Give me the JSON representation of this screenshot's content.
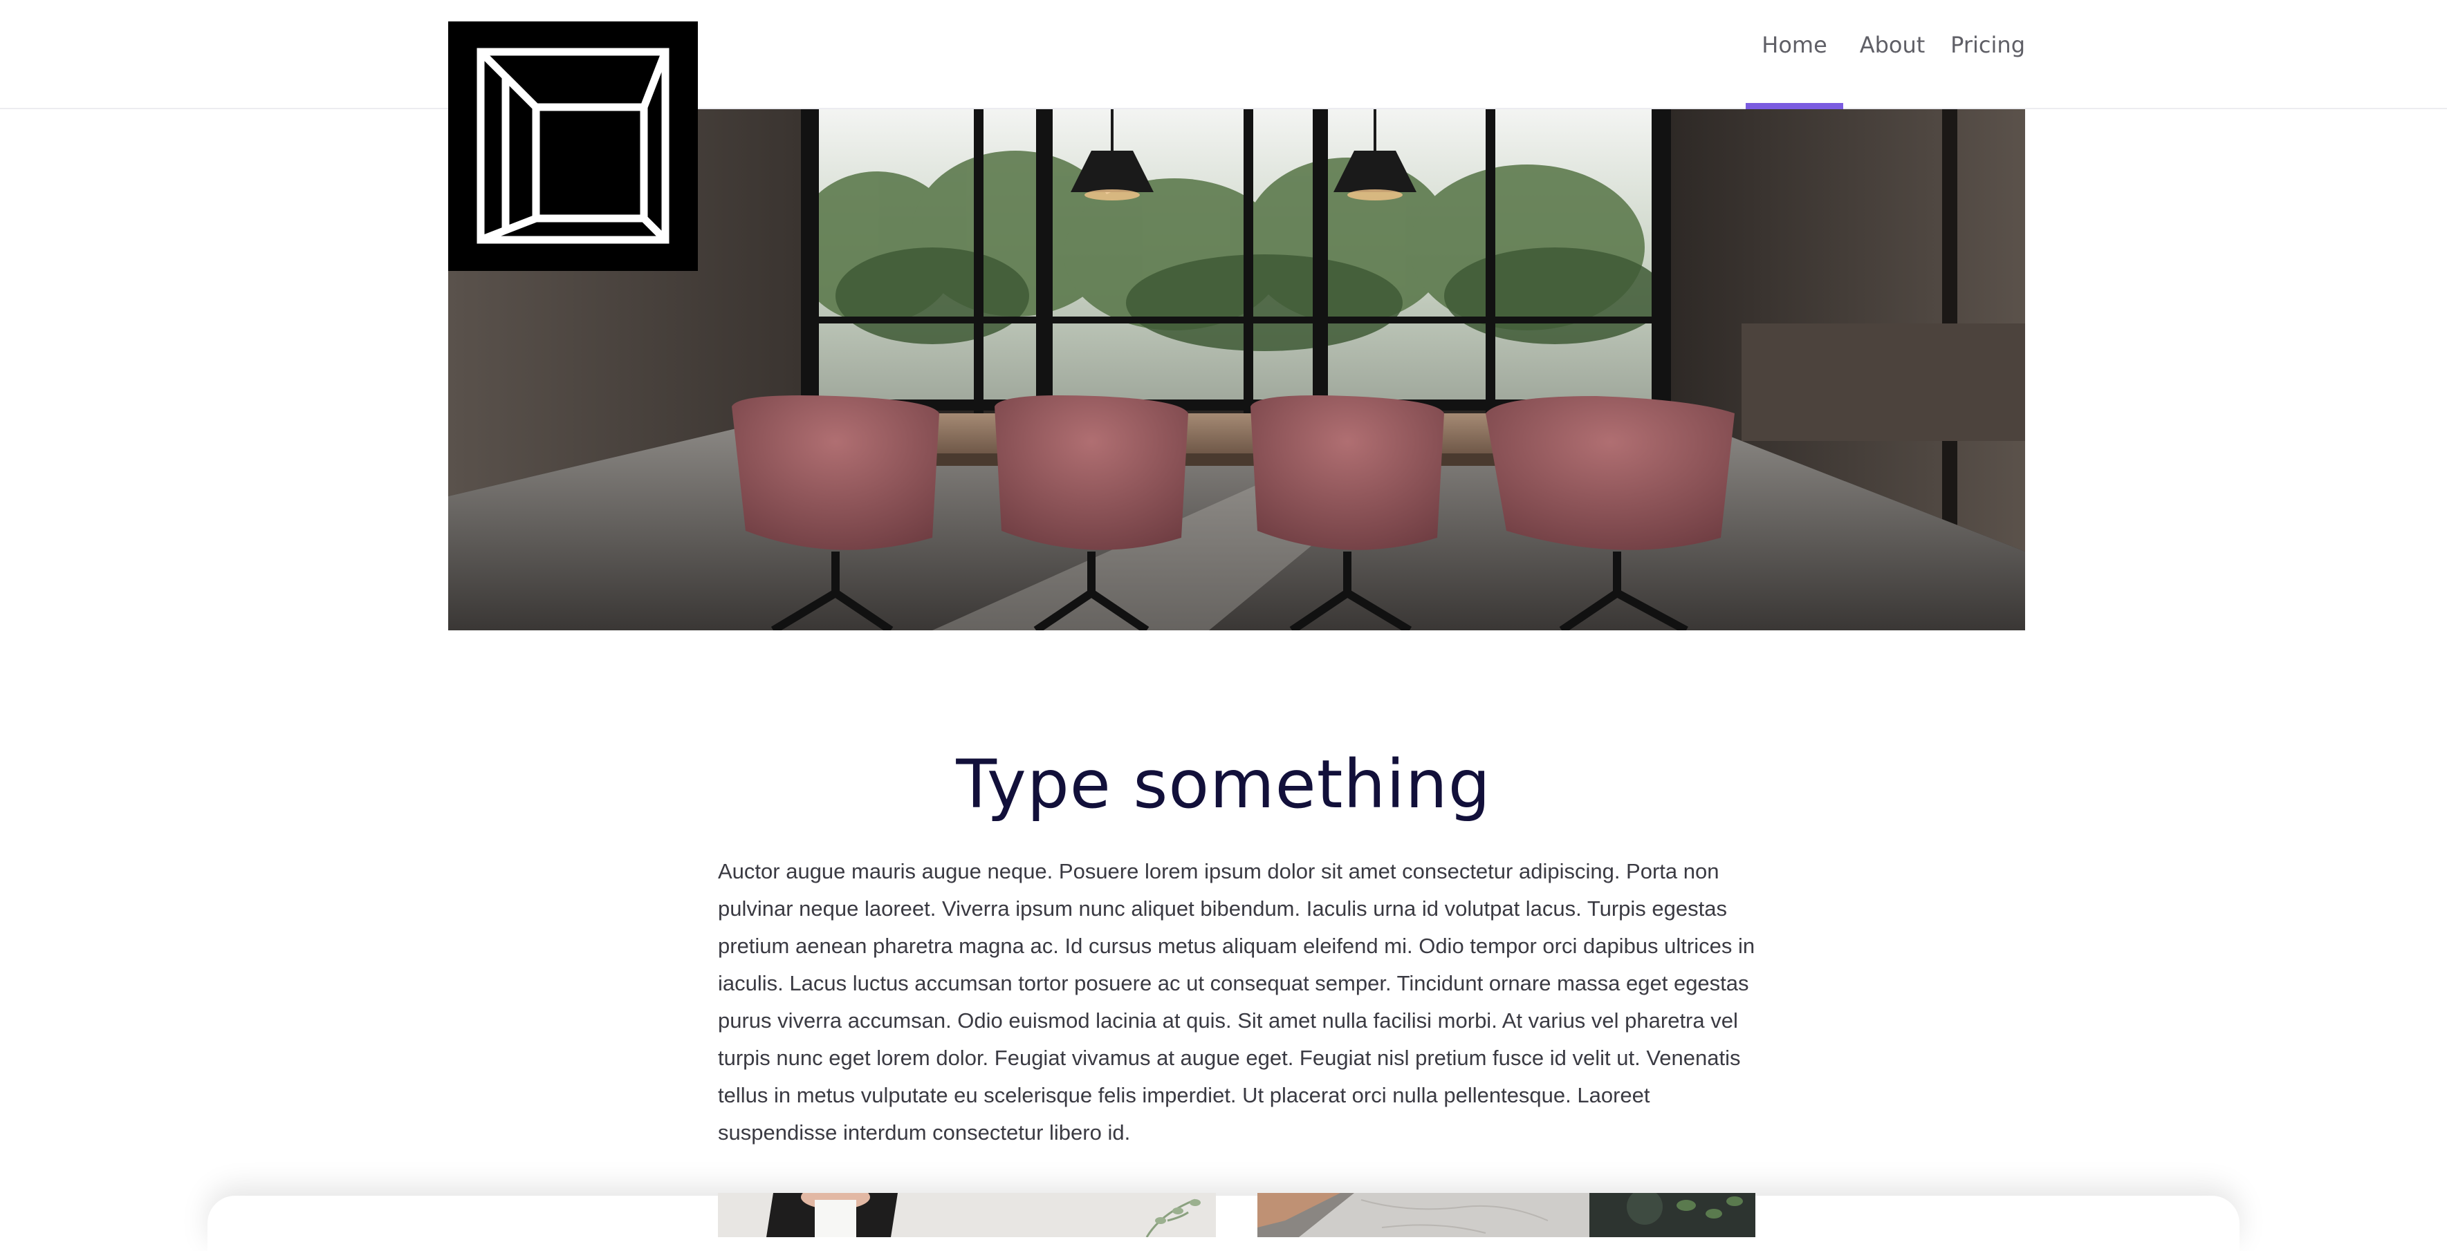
{
  "header": {
    "logo_icon": "geometric-box-logo",
    "nav": [
      {
        "label": "Home",
        "active": true
      },
      {
        "label": "About",
        "active": false
      },
      {
        "label": "Pricing",
        "active": false
      }
    ],
    "accent_color": "#7b5ce0"
  },
  "hero": {
    "image": "meeting-room-photo"
  },
  "content": {
    "title": "Type something",
    "body": "Auctor augue mauris augue neque. Posuere lorem ipsum dolor sit amet consectetur adipiscing. Porta non pulvinar neque laoreet. Viverra ipsum nunc aliquet bibendum. Iaculis urna id volutpat lacus. Turpis egestas pretium aenean pharetra magna ac. Id cursus metus aliquam eleifend mi. Odio tempor orci dapibus ultrices in iaculis. Lacus luctus accumsan tortor posuere ac ut consequat semper. Tincidunt ornare massa eget egestas purus viverra accumsan. Odio euismod lacinia at quis. Sit amet nulla facilisi morbi. At varius vel pharetra vel turpis nunc eget lorem dolor. Feugiat vivamus at augue eget. Feugiat nisl pretium fusce id velit ut. Venenatis tellus in metus vulputate eu scelerisque felis imperdiet. Ut placerat orci nulla pellentesque. Laoreet suspendisse interdum consectetur libero id."
  },
  "thumbnails": [
    {
      "image": "person-portrait-photo"
    },
    {
      "image": "laptop-desk-photo"
    }
  ]
}
